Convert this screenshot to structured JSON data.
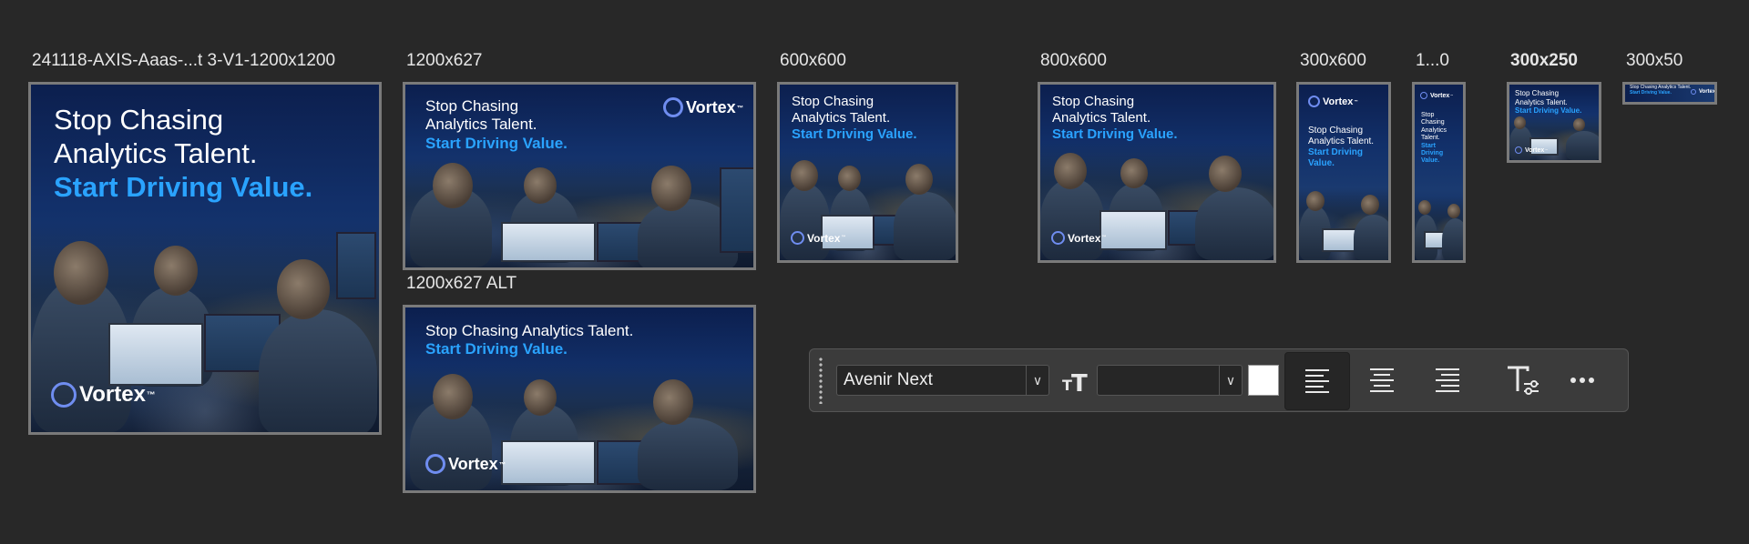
{
  "artboards": [
    {
      "label": "241118-AXIS-Aaas-...t 3-V1-1200x1200",
      "headline1": "Stop Chasing",
      "headline2": "Analytics Talent.",
      "accent": "Start Driving Value.",
      "logo": "Vortex"
    },
    {
      "label": "1200x627",
      "headline1": "Stop Chasing",
      "headline2": "Analytics Talent.",
      "accent": "Start Driving Value.",
      "logo": "Vortex"
    },
    {
      "label": "1200x627 ALT",
      "headline1": "Stop Chasing Analytics Talent.",
      "accent": "Start Driving Value.",
      "logo": "Vortex"
    },
    {
      "label": "600x600",
      "headline1": "Stop Chasing",
      "headline2": "Analytics Talent.",
      "accent": "Start Driving Value.",
      "logo": "Vortex"
    },
    {
      "label": "800x600",
      "headline1": "Stop Chasing",
      "headline2": "Analytics Talent.",
      "accent": "Start Driving Value.",
      "logo": "Vortex"
    },
    {
      "label": "300x600",
      "headline1": "Stop Chasing",
      "headline2": "Analytics Talent.",
      "accent1": "Start Driving",
      "accent2": "Value.",
      "logo": "Vortex"
    },
    {
      "label": "1...0",
      "lines": [
        "Stop",
        "Chasing",
        "Analytics",
        "Talent."
      ],
      "accents": [
        "Start",
        "Driving",
        "Value."
      ],
      "logo": "Vortex"
    },
    {
      "label": "300x250",
      "headline1": "Stop Chasing",
      "headline2": "Analytics Talent.",
      "accent": "Start Driving Value.",
      "logo": "Vortex"
    },
    {
      "label": "300x50",
      "headline1": "Stop Chasing Analytics Talent.",
      "accent": "Start Driving Value.",
      "logo": "Vortex"
    }
  ],
  "logo_tm": "™",
  "toolbar": {
    "font_family": "Avenir Next",
    "font_size": "",
    "color_swatch": "#ffffff",
    "buttons": [
      "text-size-icon",
      "align-left-icon",
      "align-center-icon",
      "align-right-icon",
      "text-options-icon",
      "more-icon"
    ],
    "active_alignment": "left"
  },
  "colors": {
    "canvas": "#282828",
    "accent": "#2aa3ff",
    "ad_bg": "#12306a",
    "logo_mark": "#6f8df0"
  }
}
